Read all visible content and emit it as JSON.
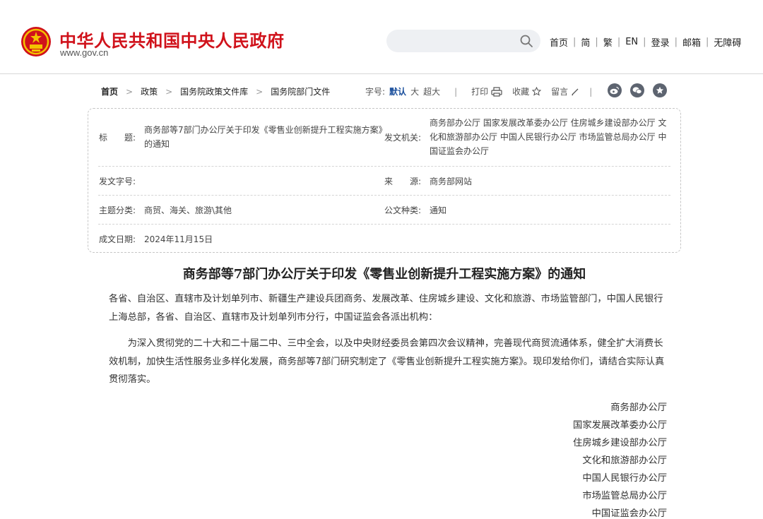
{
  "header": {
    "site_title": "中华人民共和国中央人民政府",
    "site_url": "www.gov.cn",
    "search_placeholder": "",
    "nav": [
      "首页",
      "简",
      "繁",
      "EN",
      "登录",
      "邮箱",
      "无障碍"
    ]
  },
  "breadcrumb": [
    "首页",
    "政策",
    "国务院政策文件库",
    "国务院部门文件"
  ],
  "toolbar": {
    "font_size_label": "字号:",
    "font_sizes": [
      "默认",
      "大",
      "超大"
    ],
    "active_font_size": "默认",
    "print_label": "打印",
    "favorite_label": "收藏",
    "comment_label": "留言"
  },
  "share_icons": [
    "weibo-icon",
    "wechat-icon",
    "qzone-icon"
  ],
  "info": {
    "title_label": "标　　题:",
    "title_value": "商务部等7部门办公厅关于印发《零售业创新提升工程实施方案》的通知",
    "issuer_label": "发文机关:",
    "issuer_value": "商务部办公厅 国家发展改革委办公厅 住房城乡建设部办公厅 文化和旅游部办公厅 中国人民银行办公厅 市场监管总局办公厅 中国证监会办公厅",
    "doc_no_label": "发文字号:",
    "doc_no_value": "",
    "source_label": "来　　源:",
    "source_value": "商务部网站",
    "topic_label": "主题分类:",
    "topic_value": "商贸、海关、旅游\\其他",
    "doc_type_label": "公文种类:",
    "doc_type_value": "通知",
    "date_label": "成文日期:",
    "date_value": "2024年11月15日"
  },
  "article": {
    "title": "商务部等7部门办公厅关于印发《零售业创新提升工程实施方案》的通知",
    "salutation": "各省、自治区、直辖市及计划单列市、新疆生产建设兵团商务、发展改革、住房城乡建设、文化和旅游、市场监管部门，中国人民银行上海总部，各省、自治区、直辖市及计划单列市分行，中国证监会各派出机构：",
    "body": "为深入贯彻党的二十大和二十届二中、三中全会，以及中央财经委员会第四次会议精神，完善现代商贸流通体系，健全扩大消费长效机制，加快生活性服务业多样化发展，商务部等7部门研究制定了《零售业创新提升工程实施方案》。现印发给你们，请结合实际认真贯彻落实。",
    "signatures": [
      "商务部办公厅",
      "国家发展改革委办公厅",
      "住房城乡建设部办公厅",
      "文化和旅游部办公厅",
      "中国人民银行办公厅",
      "市场监管总局办公厅",
      "中国证监会办公厅"
    ]
  },
  "colors": {
    "brand_red": "#d0121b",
    "link_blue": "#1a4f9c",
    "share_gray": "#5d6470"
  }
}
